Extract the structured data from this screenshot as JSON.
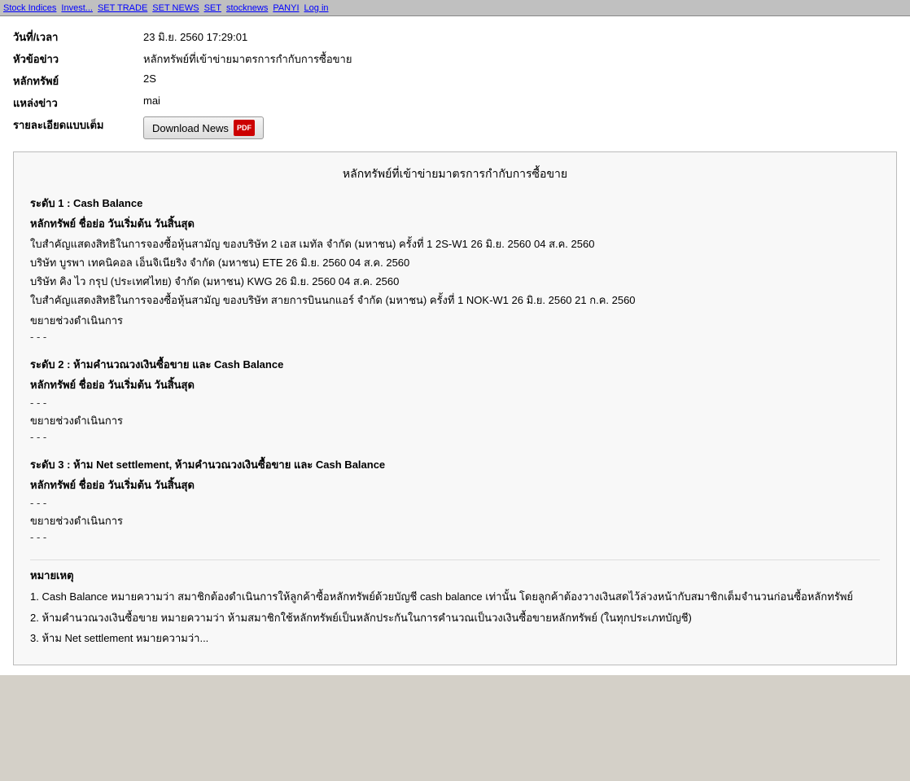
{
  "topbar": {
    "items": [
      "Stock Indices",
      "Invest...",
      "SET TRADE",
      "SET NEWS",
      "SET",
      "stocknews",
      "PANYI",
      "Log in"
    ]
  },
  "meta": {
    "datetime_label": "วันที่/เวลา",
    "datetime_value": "23 มิ.ย. 2560 17:29:01",
    "headline_label": "หัวข้อข่าว",
    "headline_value": "หลักทรัพย์ที่เข้าข่ายมาตรการกำกับการซื้อขาย",
    "security_label": "หลักทรัพย์",
    "security_value": "2S",
    "source_label": "แหล่งข่าว",
    "source_value": "mai",
    "detail_label": "รายละเอียดแบบเต็ม",
    "download_btn_label": "Download News",
    "pdf_label": "PDF"
  },
  "box": {
    "title": "หลักทรัพย์ที่เข้าข่ายมาตรการกำกับการซื้อขาย",
    "level1": {
      "header": "ระดับ 1 : Cash Balance",
      "col_header": "หลักทรัพย์   ชื่อย่อ   วันเริ่มต้น    วันสิ้นสุด",
      "rows": [
        "ใบสำคัญแสดงสิทธิในการจองซื้อหุ้นสามัญ ของบริษัท 2 เอส เมทัล จำกัด (มหาชน) ครั้งที่ 1    2S-W1    26 มิ.ย. 2560    04 ส.ค. 2560",
        "บริษัท บูรพา เทคนิคอล เอ็นจิเนียริง จำกัด (มหาชน)    ETE    26 มิ.ย. 2560    04 ส.ค. 2560",
        "บริษัท คิง ไว กรุป (ประเทศไทย) จำกัด (มหาชน)    KWG    26 มิ.ย. 2560    04 ส.ค. 2560",
        "ใบสำคัญแสดงสิทธิในการจองซื้อหุ้นสามัญ ของบริษัท สายการบินนกแอร์ จำกัด (มหาชน) ครั้งที่ 1    NOK-W1    26 มิ.ย. 2560    21 ก.ค. 2560"
      ],
      "extend_label": "ขยายช่วงดำเนินการ",
      "dashes": "-    -    -"
    },
    "level2": {
      "header": "ระดับ 2 : ห้ามคำนวณวงเงินซื้อขาย  และ Cash Balance",
      "col_header": "หลักทรัพย์    ชื่อย่อ   วันเริ่มต้น    วันสิ้นสุด",
      "dashes": "-    -    -",
      "extend_label": "ขยายช่วงดำเนินการ",
      "dashes2": "-    -    -"
    },
    "level3": {
      "header": "ระดับ 3 : ห้าม Net settlement, ห้ามคำนวณวงเงินซื้อขาย  และ Cash Balance",
      "col_header": "หลักทรัพย์    ชื่อย่อ   วันเริ่มต้น    วันสิ้นสุด",
      "dashes": "-    -    -",
      "extend_label": "ขยายช่วงดำเนินการ",
      "dashes2": "-    -    -"
    },
    "notes": {
      "title": "หมายเหตุ",
      "items": [
        "1. Cash Balance หมายความว่า สมาชิกต้องดำเนินการให้ลูกค้าซื้อหลักทรัพย์ด้วยบัญชี cash balance เท่านั้น โดยลูกค้าต้องวางเงินสดไว้ล่วงหน้ากับสมาชิกเต็มจำนวนก่อนซื้อหลักทรัพย์",
        "2. ห้ามคำนวณวงเงินซื้อขาย หมายความว่า ห้ามสมาชิกใช้หลักทรัพย์เป็นหลักประกันในการคำนวณเป็นวงเงินซื้อขายหลักทรัพย์ (ในทุกประเภทบัญชี)",
        "3. ห้าม Net settlement หมายความว่า..."
      ]
    }
  }
}
